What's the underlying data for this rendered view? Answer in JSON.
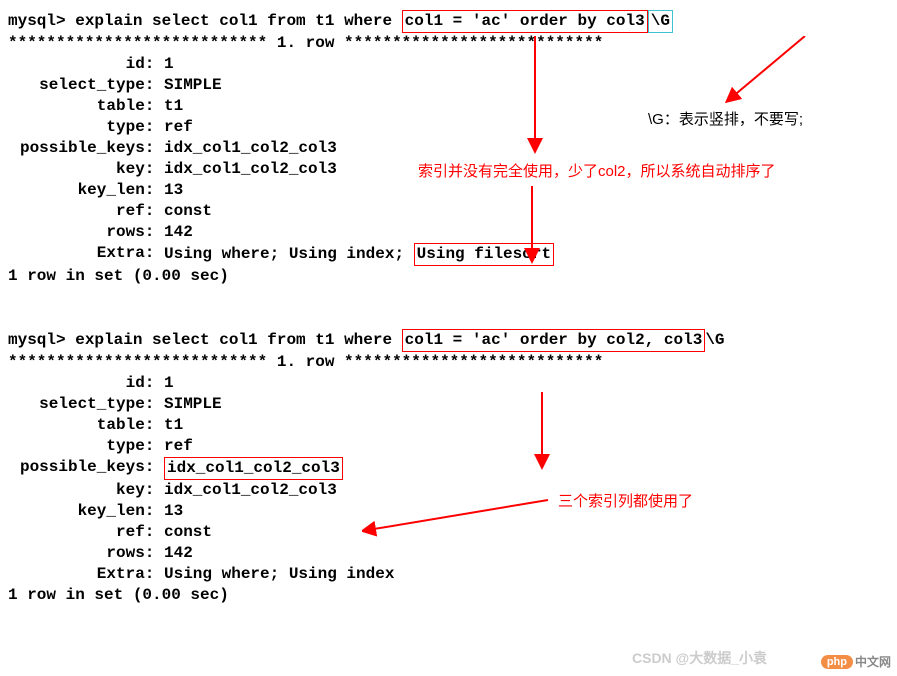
{
  "block1": {
    "prompt": "mysql> ",
    "cmd_pre": "explain select col1 from t1 where ",
    "cmd_box": "col1 = 'ac' order by col3",
    "cmd_g": "\\G",
    "sep_left": "*************************** ",
    "sep_mid": "1. row",
    "sep_right": " ***************************",
    "id_l": "id: ",
    "id_v": "1",
    "st_l": "select_type: ",
    "st_v": "SIMPLE",
    "tb_l": "table: ",
    "tb_v": "t1",
    "ty_l": "type: ",
    "ty_v": "ref",
    "pk_l": "possible_keys: ",
    "pk_v": "idx_col1_col2_col3",
    "ky_l": "key: ",
    "ky_v": "idx_col1_col2_col3",
    "kl_l": "key_len: ",
    "kl_v": "13",
    "rf_l": "ref: ",
    "rf_v": "const",
    "rw_l": "rows: ",
    "rw_v": "142",
    "ex_l": "Extra: ",
    "ex_v1": "Using where; Using index; ",
    "ex_box": "Using filesort",
    "summary": "1 row in set (0.00 sec)"
  },
  "block2": {
    "prompt": "mysql> ",
    "cmd_pre": "explain select col1 from t1 where ",
    "cmd_box": "col1 = 'ac' order by col2, col3",
    "cmd_g": "\\G",
    "sep_left": "*************************** ",
    "sep_mid": "1. row",
    "sep_right": " ***************************",
    "id_l": "id: ",
    "id_v": "1",
    "st_l": "select_type: ",
    "st_v": "SIMPLE",
    "tb_l": "table: ",
    "tb_v": "t1",
    "ty_l": "type: ",
    "ty_v": "ref",
    "pk_l": "possible_keys: ",
    "pk_box": "idx_col1_col2_col3",
    "ky_l": "key: ",
    "ky_v": "idx_col1_col2_col3",
    "kl_l": "key_len: ",
    "kl_v": "13",
    "rf_l": "ref: ",
    "rf_v": "const",
    "rw_l": "rows: ",
    "rw_v": "142",
    "ex_l": "Extra: ",
    "ex_v": "Using where; Using index",
    "summary": "1 row in set (0.00 sec)"
  },
  "annotations": {
    "g_note": "\\G：表示竖排，不要写;",
    "index_note": "索引并没有完全使用，少了col2，所以系统自动排序了",
    "three_cols": "三个索引列都使用了"
  },
  "watermark": {
    "csdn": "CSDN @大数据_小袁",
    "php": "php",
    "cn": "中文网"
  }
}
